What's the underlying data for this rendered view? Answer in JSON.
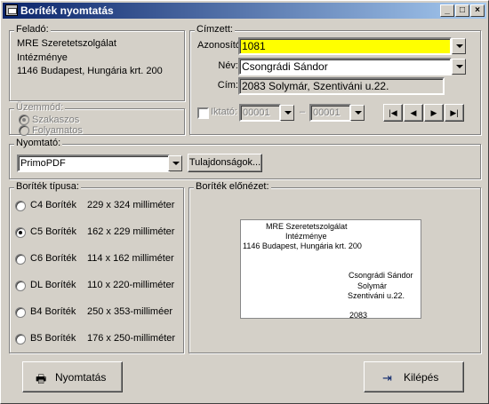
{
  "window": {
    "title": "Boríték nyomtatás"
  },
  "sender": {
    "legend": "Feladó:",
    "line1": "MRE Szeretetszolgálat",
    "line2": "Intézménye",
    "line3": "1146  Budapest, Hungária krt. 200"
  },
  "mode": {
    "legend": "Üzemmód:",
    "option1": "Szakaszos",
    "option2": "Folyamatos"
  },
  "recipient": {
    "legend": "Címzett:",
    "id_label": "Azonosító:",
    "id_value": "1081",
    "name_label": "Név:",
    "name_value": "Csongrádi Sándor",
    "address_label": "Cím:",
    "address_value": "2083 Solymár, Szentiváni u.22.",
    "iktato_label": "Iktató:",
    "from_value": "00001",
    "dash": "–",
    "to_value": "00001"
  },
  "printer": {
    "legend": "Nyomtató:",
    "selected": "PrimoPDF",
    "properties_button": "Tulajdonságok..."
  },
  "envelope_types": {
    "legend": "Boríték típusa:",
    "options": [
      {
        "name": "C4 Boríték",
        "size": "229 x 324 milliméter"
      },
      {
        "name": "C5 Boríték",
        "size": "162 x 229 milliméter"
      },
      {
        "name": "C6 Boríték",
        "size": "114 x 162 milliméter"
      },
      {
        "name": "DL Boríték",
        "size": "110 x 220-milliméter"
      },
      {
        "name": "B4 Boríték",
        "size": "250 x 353-milliméer"
      },
      {
        "name": "B5 Boríték",
        "size": "176 x 250-milliméter"
      }
    ],
    "selected_index": 1
  },
  "preview": {
    "legend": "Boríték előnézet:",
    "sender_line1": "MRE Szeretetszolgálat",
    "sender_line2": "Intézménye",
    "sender_line3": "1146  Budapest, Hungária krt. 200",
    "recipient_line1": "Csongrádi Sándor",
    "recipient_line2": "Solymár",
    "recipient_line3": "Szentiváni u.22.",
    "recipient_line4": "2083"
  },
  "buttons": {
    "print": "Nyomtatás",
    "exit": "Kilépés"
  }
}
